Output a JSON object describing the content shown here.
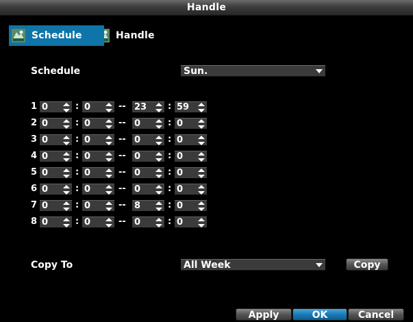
{
  "window": {
    "title": "Handle"
  },
  "tabs": [
    {
      "label": "Schedule",
      "active": true,
      "icon": "camera-event-icon"
    },
    {
      "label": "Handle",
      "active": false,
      "icon": "camera-event-icon"
    }
  ],
  "schedule": {
    "label": "Schedule",
    "day_value": "Sun.",
    "rows": [
      {
        "index": "1",
        "start_h": "0",
        "start_m": "0",
        "end_h": "23",
        "end_m": "59"
      },
      {
        "index": "2",
        "start_h": "0",
        "start_m": "0",
        "end_h": "0",
        "end_m": "0"
      },
      {
        "index": "3",
        "start_h": "0",
        "start_m": "0",
        "end_h": "0",
        "end_m": "0"
      },
      {
        "index": "4",
        "start_h": "0",
        "start_m": "0",
        "end_h": "0",
        "end_m": "0"
      },
      {
        "index": "5",
        "start_h": "0",
        "start_m": "0",
        "end_h": "0",
        "end_m": "0"
      },
      {
        "index": "6",
        "start_h": "0",
        "start_m": "0",
        "end_h": "0",
        "end_m": "0"
      },
      {
        "index": "7",
        "start_h": "0",
        "start_m": "0",
        "end_h": "8",
        "end_m": "0"
      },
      {
        "index": "8",
        "start_h": "0",
        "start_m": "0",
        "end_h": "0",
        "end_m": "0"
      }
    ],
    "time_sep": ":",
    "range_sep": "--"
  },
  "copy": {
    "label": "Copy To",
    "target_value": "All Week",
    "button_label": "Copy"
  },
  "footer": {
    "apply_label": "Apply",
    "ok_label": "OK",
    "cancel_label": "Cancel"
  },
  "colors": {
    "accent": "#0f74a8",
    "field_bg": "#3b3b3b",
    "background": "#000000"
  }
}
